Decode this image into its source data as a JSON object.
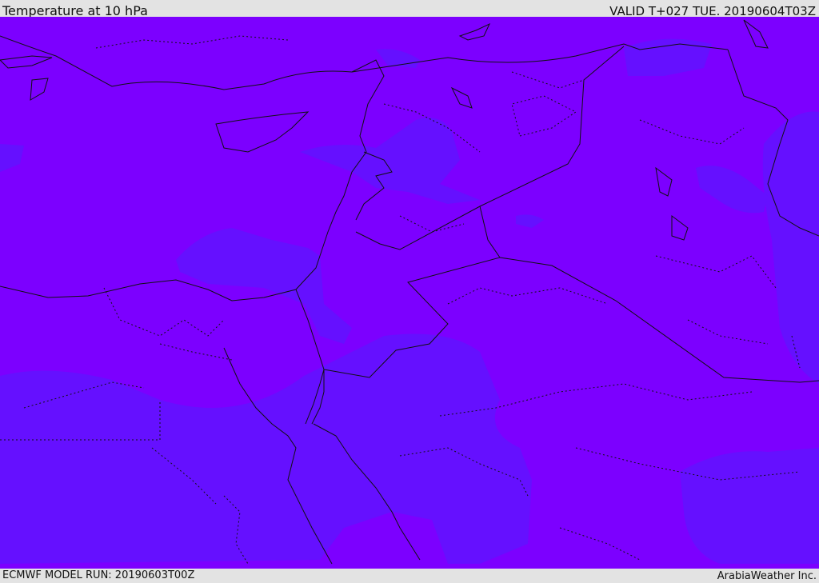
{
  "header": {
    "title": "Temperature at 10 hPa",
    "valid": "VALID T+027 TUE. 20190604T03Z"
  },
  "footer": {
    "model_run": "ECMWF MODEL RUN: 20190603T00Z",
    "credit": "ArabiaWeather Inc."
  },
  "map": {
    "fill_colors": {
      "warm": "#7c00ff",
      "cool": "#6510ff"
    },
    "border_color": "#111111"
  }
}
